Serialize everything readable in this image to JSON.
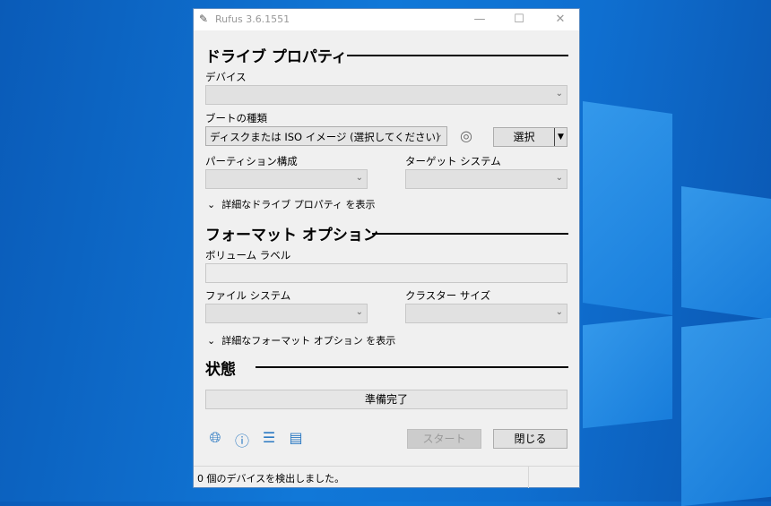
{
  "window": {
    "title": "Rufus 3.6.1551",
    "minimize": "—",
    "maximize": "☐",
    "close": "✕"
  },
  "drive": {
    "heading": "ドライブ プロパティ",
    "device_label": "デバイス",
    "device_value": "",
    "boot_label": "ブートの種類",
    "boot_value": "ディスクまたは ISO イメージ (選択してください)",
    "select_button": "選択",
    "partition_label": "パーティション構成",
    "target_label": "ターゲット システム",
    "advanced": "詳細なドライブ プロパティ を表示"
  },
  "format": {
    "heading": "フォーマット オプション",
    "volume_label": "ボリューム ラベル",
    "volume_value": "",
    "fs_label": "ファイル システム",
    "cluster_label": "クラスター サイズ",
    "advanced": "詳細なフォーマット オプション を表示"
  },
  "state": {
    "heading": "状態",
    "progress_text": "準備完了",
    "progress": 0
  },
  "buttons": {
    "start": "スタート",
    "close": "閉じる"
  },
  "statusbar": {
    "text": "0 個のデバイスを検出しました。"
  }
}
